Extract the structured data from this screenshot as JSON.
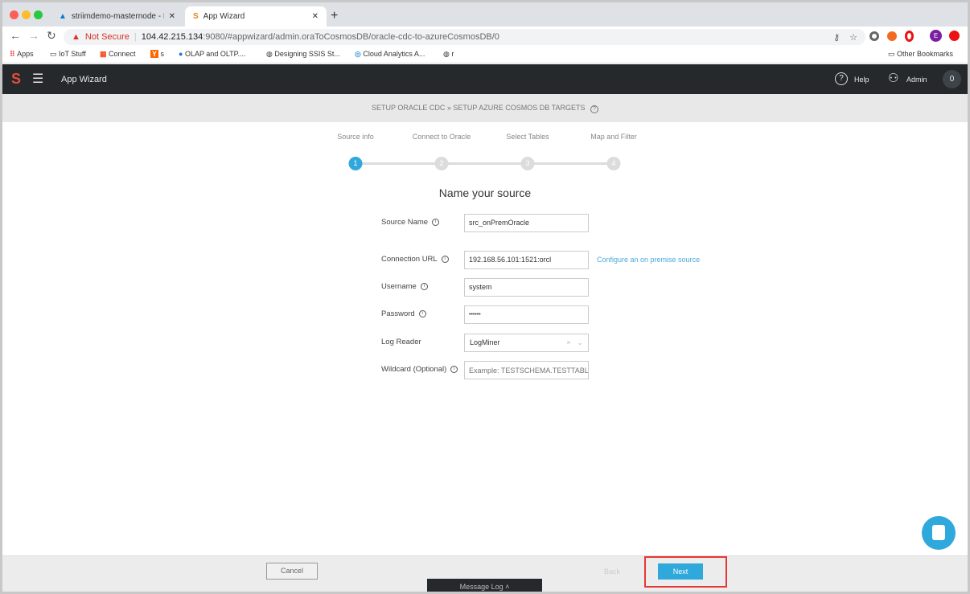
{
  "browser": {
    "tabs": [
      {
        "label": "striimdemo-masternode - Micr",
        "active": false
      },
      {
        "label": "App Wizard",
        "active": true
      }
    ],
    "not_secure": "Not Secure",
    "url_host": "104.42.215.134",
    "url_rest": ":9080/#appwizard/admin.oraToCosmosDB/oracle-cdc-to-azureCosmosDB/0",
    "bookmarks": [
      "Apps",
      "IoT Stuff",
      "Connect",
      "s",
      "OLAP and OLTP....",
      "Designing SSIS St...",
      "Cloud Analytics A...",
      "r"
    ],
    "other_bookmarks": "Other Bookmarks",
    "profile_initial": "E"
  },
  "header": {
    "title": "App Wizard",
    "help": "Help",
    "user": "Admin",
    "notifications": "0"
  },
  "breadcrumb": {
    "step1": "SETUP ORACLE CDC",
    "separator": "»",
    "step2": "SETUP AZURE COSMOS DB TARGETS"
  },
  "stepper": {
    "steps": [
      {
        "label": "Source info",
        "num": "1"
      },
      {
        "label": "Connect to Oracle",
        "num": "2"
      },
      {
        "label": "Select Tables",
        "num": "3"
      },
      {
        "label": "Map and Filter",
        "num": "4"
      }
    ],
    "current": 1,
    "accent": "#2fa8dc"
  },
  "form": {
    "title": "Name your source",
    "source_name": {
      "label": "Source Name",
      "value": "src_onPremOracle"
    },
    "connection_url": {
      "label": "Connection URL",
      "value": "192.168.56.101:1521:orcl"
    },
    "configure_link": "Configure an on premise source",
    "username": {
      "label": "Username",
      "value": "system"
    },
    "password": {
      "label": "Password",
      "value": "••••••"
    },
    "log_reader": {
      "label": "Log Reader",
      "value": "LogMiner"
    },
    "wildcard": {
      "label": "Wildcard (Optional)",
      "placeholder": "Example: TESTSCHEMA.TESTTABLE"
    }
  },
  "footer": {
    "cancel": "Cancel",
    "back": "Back",
    "next": "Next",
    "message_log": "Message Log"
  }
}
